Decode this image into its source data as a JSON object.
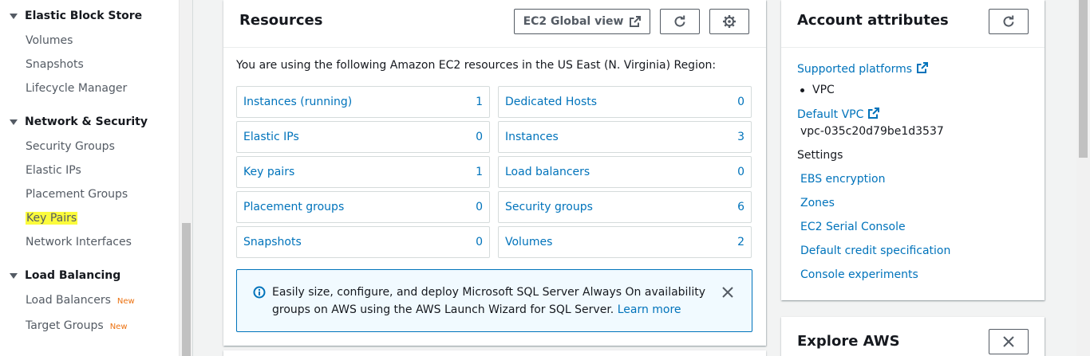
{
  "sidebar": {
    "sections": [
      {
        "title": "Elastic Block Store",
        "items": [
          {
            "label": "Volumes"
          },
          {
            "label": "Snapshots"
          },
          {
            "label": "Lifecycle Manager"
          }
        ]
      },
      {
        "title": "Network & Security",
        "items": [
          {
            "label": "Security Groups"
          },
          {
            "label": "Elastic IPs"
          },
          {
            "label": "Placement Groups"
          },
          {
            "label": "Key Pairs"
          },
          {
            "label": "Network Interfaces"
          }
        ]
      },
      {
        "title": "Load Balancing",
        "items": [
          {
            "label": "Load Balancers",
            "badge": "New"
          },
          {
            "label": "Target Groups",
            "badge": "New"
          }
        ]
      }
    ],
    "highlighted_item": "Key Pairs"
  },
  "resources": {
    "title": "Resources",
    "global_view_label": "EC2 Global view",
    "refresh_icon": "refresh-icon",
    "settings_icon": "gear-icon",
    "description": "You are using the following Amazon EC2 resources in the US East (N. Virginia) Region:",
    "items": [
      {
        "label": "Instances (running)",
        "value": "1"
      },
      {
        "label": "Dedicated Hosts",
        "value": "0"
      },
      {
        "label": "Elastic IPs",
        "value": "0"
      },
      {
        "label": "Instances",
        "value": "3"
      },
      {
        "label": "Key pairs",
        "value": "1"
      },
      {
        "label": "Load balancers",
        "value": "0"
      },
      {
        "label": "Placement groups",
        "value": "0"
      },
      {
        "label": "Security groups",
        "value": "6"
      },
      {
        "label": "Snapshots",
        "value": "0"
      },
      {
        "label": "Volumes",
        "value": "2"
      }
    ],
    "info_text": "Easily size, configure, and deploy Microsoft SQL Server Always On availability groups on AWS using the AWS Launch Wizard for SQL Server.",
    "info_link": "Learn more"
  },
  "account_attributes": {
    "title": "Account attributes",
    "supported_platforms_label": "Supported platforms",
    "platform_value": "VPC",
    "default_vpc_label": "Default VPC",
    "default_vpc_value": "vpc-035c20d79be1d3537",
    "settings_label": "Settings",
    "settings_links": [
      "EBS encryption",
      "Zones",
      "EC2 Serial Console",
      "Default credit specification",
      "Console experiments"
    ]
  },
  "explore": {
    "title": "Explore AWS"
  },
  "colors": {
    "link": "#0073bb",
    "highlight": "#fbfb3c",
    "new_badge": "#ec7211",
    "info_bg": "#f1faff"
  }
}
